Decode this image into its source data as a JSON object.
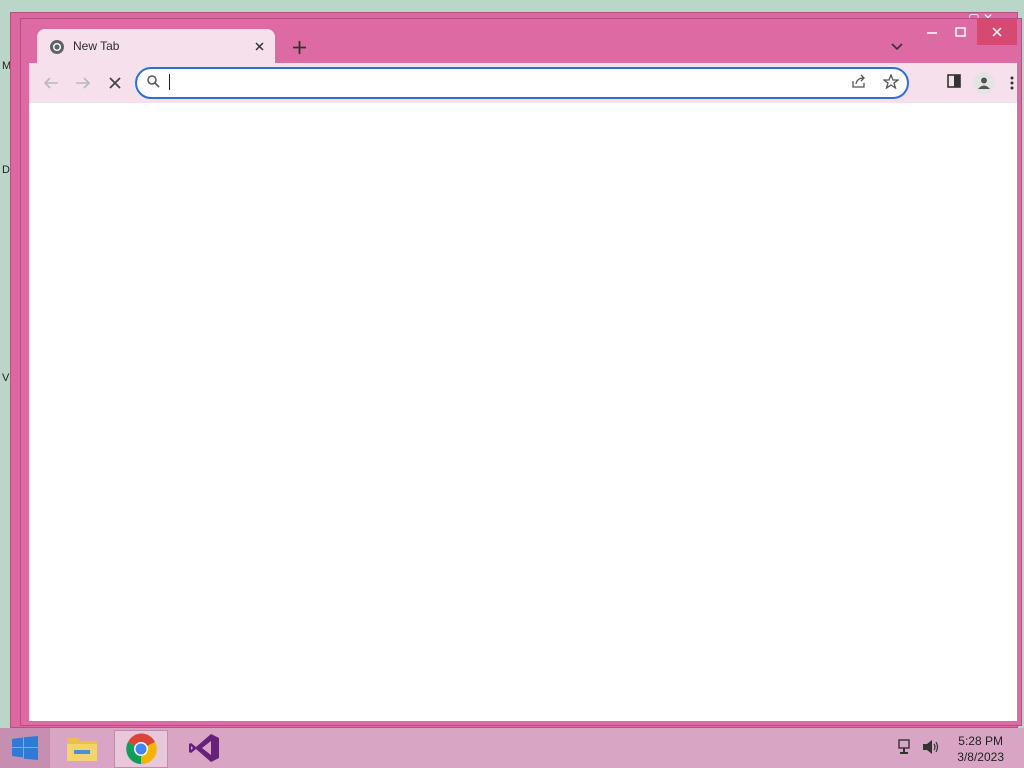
{
  "desktop": {
    "glyphs": [
      "M",
      "D",
      "V"
    ]
  },
  "browser": {
    "tab": {
      "title": "New Tab",
      "favicon": "chrome-newtab-icon"
    },
    "new_tab_icon": "plus-icon",
    "tab_menu_icon": "chevron-down-icon",
    "window_controls": {
      "minimize": "minimize-icon",
      "maximize": "maximize-icon",
      "close": "close-icon"
    },
    "toolbar": {
      "back_icon": "arrow-left-icon",
      "forward_icon": "arrow-right-icon",
      "stop_icon": "x-icon",
      "search_icon": "search-icon",
      "share_icon": "share-icon",
      "bookmark_icon": "star-icon",
      "side_panel_icon": "side-panel-icon",
      "profile_icon": "person-icon",
      "menu_icon": "kebab-icon"
    },
    "omnibox": {
      "value": "",
      "placeholder": ""
    }
  },
  "taskbar": {
    "items": [
      "start",
      "file-explorer",
      "chrome",
      "visual-studio"
    ],
    "clock": {
      "time": "5:28 PM",
      "date": "3/8/2023"
    }
  },
  "colors": {
    "frame": "#de6aa3",
    "toolbar": "#f6e0eb",
    "omnibox_focus": "#2f6fd0",
    "taskbar": "#d8a6c4"
  }
}
